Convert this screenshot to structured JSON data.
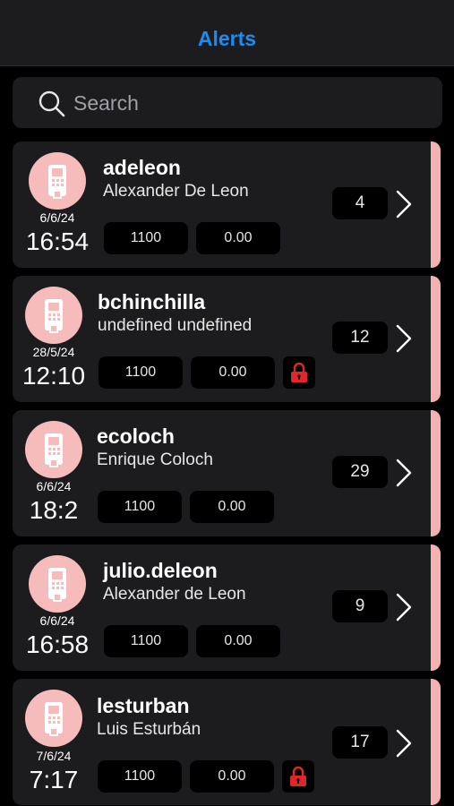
{
  "header": {
    "title": "Alerts"
  },
  "search": {
    "placeholder": "Search"
  },
  "alerts": [
    {
      "username": "adeleon",
      "full_name": "Alexander De Leon",
      "date": "6/6/24",
      "time": "16:54",
      "value_1": "1100",
      "value_2": "0.00",
      "count": "4",
      "locked": false
    },
    {
      "username": "bchinchilla",
      "full_name": "undefined undefined",
      "date": "28/5/24",
      "time": "12:10",
      "value_1": "1100",
      "value_2": "0.00",
      "count": "12",
      "locked": true
    },
    {
      "username": "ecoloch",
      "full_name": "Enrique Coloch",
      "date": "6/6/24",
      "time": "18:2",
      "value_1": "1100",
      "value_2": "0.00",
      "count": "29",
      "locked": false
    },
    {
      "username": "julio.deleon",
      "full_name": "Alexander de Leon",
      "date": "6/6/24",
      "time": "16:58",
      "value_1": "1100",
      "value_2": "0.00",
      "count": "9",
      "locked": false
    },
    {
      "username": "lesturban",
      "full_name": "Luis Esturbán",
      "date": "7/6/24",
      "time": "7:17",
      "value_1": "1100",
      "value_2": "0.00",
      "count": "17",
      "locked": true
    }
  ],
  "colors": {
    "accent": "#1e8bf0",
    "card_background": "#1c1c1e",
    "stripe": "#f4b1b1",
    "avatar": "#f6bcbc",
    "lock": "#e0262d"
  },
  "icons": {
    "search": "search-icon",
    "avatar": "card-terminal-icon",
    "lock": "lock-icon",
    "chevron": "chevron-right-icon"
  }
}
